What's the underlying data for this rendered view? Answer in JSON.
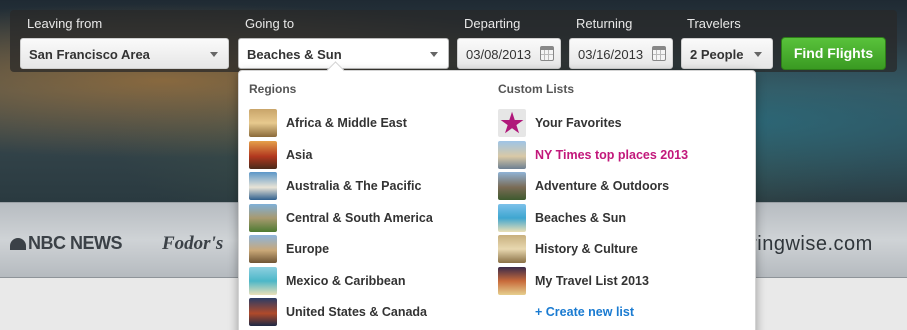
{
  "search": {
    "leaving_label": "Leaving from",
    "leaving_value": "San Francisco Area",
    "going_label": "Going to",
    "going_value": "Beaches & Sun",
    "departing_label": "Departing",
    "departing_value": "03/08/2013",
    "returning_label": "Returning",
    "returning_value": "03/16/2013",
    "travelers_label": "Travelers",
    "travelers_value": "2 People",
    "find_button": "Find Flights"
  },
  "dropdown": {
    "regions_heading": "Regions",
    "regions": [
      {
        "label": "Africa & Middle East",
        "thumb": "africa-thumb"
      },
      {
        "label": "Asia",
        "thumb": "asia-thumb"
      },
      {
        "label": "Australia & The Pacific",
        "thumb": "australia-thumb"
      },
      {
        "label": "Central & South America",
        "thumb": "central-america-thumb"
      },
      {
        "label": "Europe",
        "thumb": "europe-thumb"
      },
      {
        "label": "Mexico & Caribbean",
        "thumb": "mexico-thumb"
      },
      {
        "label": "United States & Canada",
        "thumb": "usa-thumb"
      }
    ],
    "lists_heading": "Custom Lists",
    "lists": [
      {
        "label": "Your Favorites",
        "thumb": "star-icon"
      },
      {
        "label": "NY Times top places 2013",
        "thumb": "nytimes-thumb"
      },
      {
        "label": "Adventure & Outdoors",
        "thumb": "adventure-thumb"
      },
      {
        "label": "Beaches & Sun",
        "thumb": "beach-thumb"
      },
      {
        "label": "History & Culture",
        "thumb": "history-thumb"
      },
      {
        "label": "My Travel List 2013",
        "thumb": "travel-list-thumb"
      }
    ],
    "create_list": "+ Create new list",
    "star_glyph": "★"
  },
  "press": {
    "nbc": "NBC NEWS",
    "fodors": "Fodor's",
    "springwise": "springwise.com"
  },
  "colors": {
    "accent_green": "#3a9a22",
    "highlight_pink": "#c2187b",
    "link_blue": "#1a7bd1"
  }
}
